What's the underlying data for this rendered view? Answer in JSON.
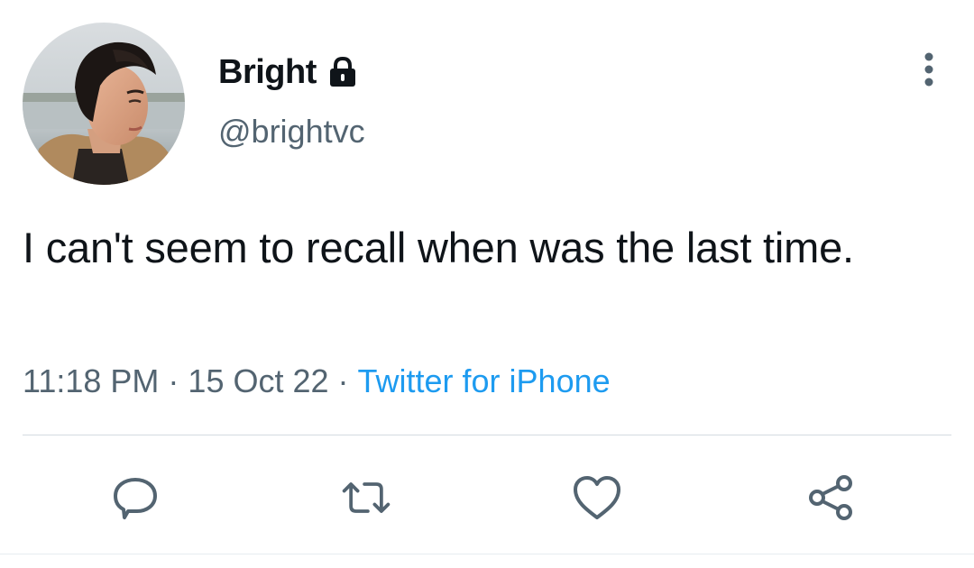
{
  "user": {
    "display_name": "Bright",
    "handle": "@brightvc",
    "protected_icon": "lock-icon",
    "avatar": "profile-photo"
  },
  "tweet": {
    "text": "I can't seem to recall when was the last time."
  },
  "meta": {
    "time": "11:18 PM",
    "separator": "·",
    "date": "15 Oct 22",
    "source": "Twitter for iPhone"
  },
  "actions": [
    {
      "name": "reply",
      "icon": "comment-icon"
    },
    {
      "name": "retweet",
      "icon": "retweet-icon"
    },
    {
      "name": "like",
      "icon": "heart-icon"
    },
    {
      "name": "share",
      "icon": "share-icon"
    }
  ],
  "colors": {
    "text_primary": "#0f1419",
    "text_secondary": "#536471",
    "link": "#1d9bf0",
    "icon": "#536471",
    "divider": "#d4dbe0"
  }
}
